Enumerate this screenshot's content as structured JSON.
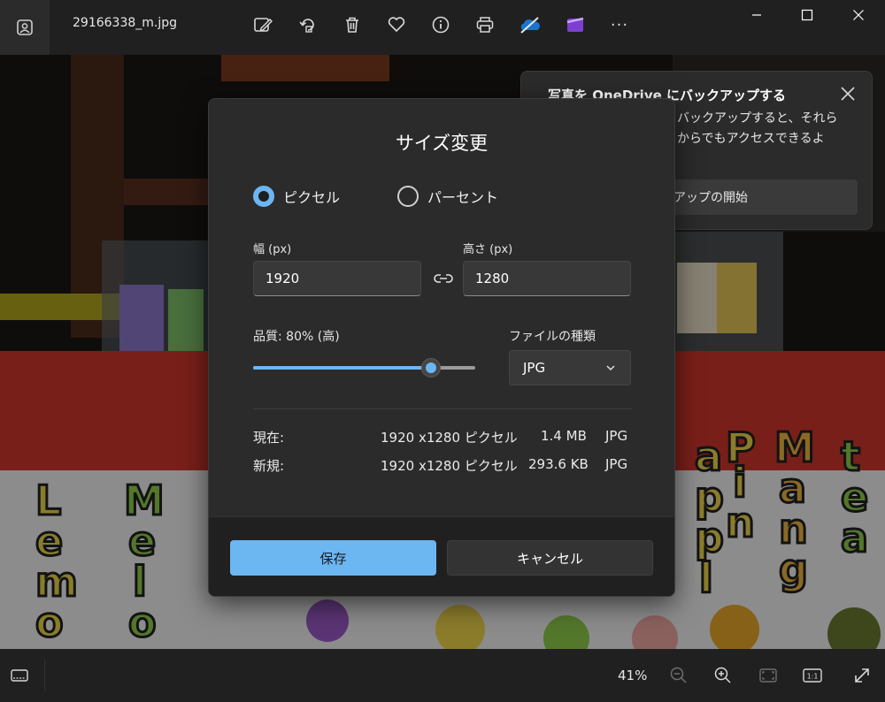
{
  "window": {
    "filename": "29166338_m.jpg"
  },
  "toolbar": {
    "icons": [
      "edit-image-icon",
      "rotate-icon",
      "delete-icon",
      "favorite-icon",
      "info-icon",
      "print-icon",
      "onedrive-icon",
      "clipchamp-icon",
      "more-icon"
    ],
    "more_label": "···"
  },
  "window_controls": {
    "icons": [
      "minimize-icon",
      "maximize-icon",
      "close-icon"
    ]
  },
  "notification": {
    "title": "写真を OneDrive にバックアップする",
    "body_line1": "バックアップすると、それら",
    "body_line2": "からでもアクセスできるよ",
    "button_label": "アップの開始"
  },
  "dialog": {
    "title": "サイズ変更",
    "mode_pixels_label": "ピクセル",
    "mode_percent_label": "パーセント",
    "mode_selected": "pixels",
    "width_label": "幅 (px)",
    "width_value": "1920",
    "height_label": "高さ (px)",
    "height_value": "1280",
    "quality_label": "品質: 80% (高)",
    "quality_fraction": 0.8,
    "filetype_label": "ファイルの種類",
    "filetype_value": "JPG",
    "current": {
      "label": "現在:",
      "dimensions": "1920 x1280 ピクセル",
      "size": "1.4 MB",
      "format": "JPG"
    },
    "new": {
      "label": "新規:",
      "dimensions": "1920 x1280 ピクセル",
      "size": "293.6 KB",
      "format": "JPG"
    },
    "save_label": "保存",
    "cancel_label": "キャンセル"
  },
  "statusbar": {
    "zoom_level": "41%"
  },
  "photo_signs": {
    "words": [
      "Lemon",
      "Melon",
      "apple",
      "Pine",
      "Mango",
      "Green tea"
    ]
  },
  "colors": {
    "accent": "#6cb6f2",
    "dialog_bg": "#2b2b2b",
    "toolbar_bg": "#202020",
    "stall_red": "#d0362b"
  }
}
